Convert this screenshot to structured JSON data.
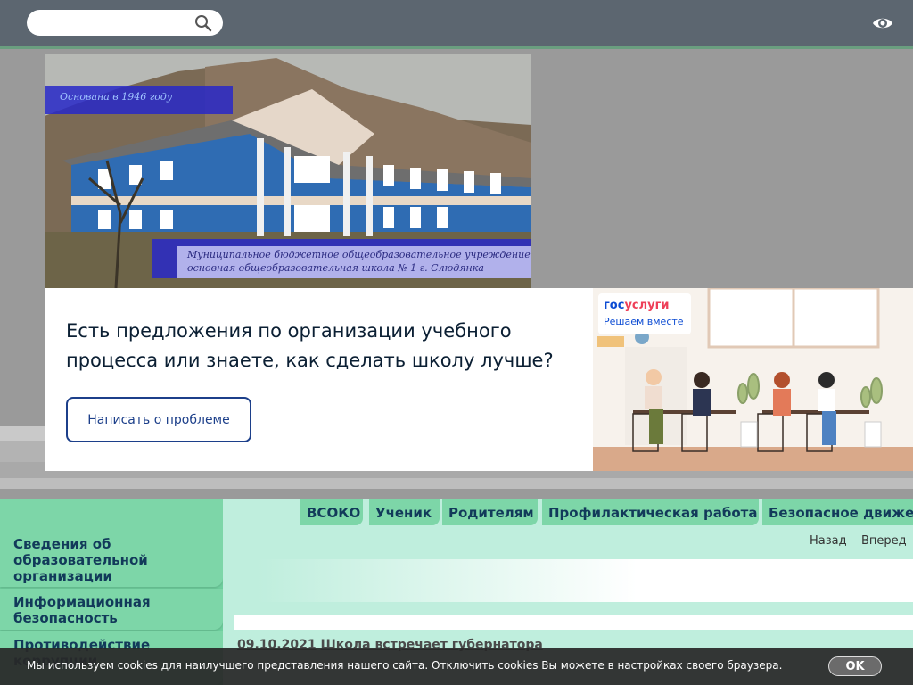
{
  "search": {
    "placeholder": "",
    "value": ""
  },
  "accessibility": {
    "icon": "eye-icon"
  },
  "header": {
    "founded": "Основана в 1946 году",
    "school_line1": "Муниципальное бюджетное общеобразовательное учреждение",
    "school_line2": "основная общеобразовательная школа № 1 г. Слюдянка"
  },
  "banner": {
    "title": "Есть предложения по организации учебного процесса или знаете, как сделать школу лучше?",
    "button": "Написать о проблеме",
    "logo_part1": "гос",
    "logo_part2": "услуги",
    "logo_sub": "Решаем вместе"
  },
  "menu": {
    "tabs": [
      "ВСОКО",
      "Ученик",
      "Родителям",
      "Профилактическая работа",
      "Безопасное движе"
    ]
  },
  "sidebar": {
    "items": [
      "Сведения об образовательной организации",
      "Информационная безопасность",
      "Противодействие коррупции"
    ]
  },
  "nav": {
    "back": "Назад",
    "forward": "Вперед"
  },
  "news": {
    "date": "09.10.2021",
    "title": "Школа встречает губернатора"
  },
  "cookie": {
    "text": "Мы используем cookies для наилучшего представления нашего сайта. Отключить cookies Вы можете в настройках своего браузера.",
    "ok": "OK"
  },
  "colors": {
    "topbar": "#5c6670",
    "menu_green": "#7dd6a8",
    "content_bg": "#bfeedd",
    "gos_blue": "#0d4cd3",
    "gos_red": "#ee3f58"
  }
}
